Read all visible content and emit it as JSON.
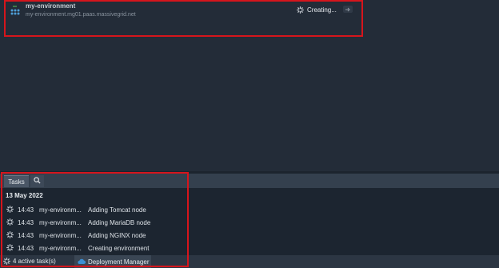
{
  "environment": {
    "name": "my-environment",
    "url": "my-environment.mg01.paas.massivegrid.net",
    "status": "Creating...",
    "icon": "nodes-icon",
    "action_icon": "arrow-icon"
  },
  "tabs": [
    {
      "label": "Tasks",
      "icon": null
    },
    {
      "label": "",
      "icon": "search-icon"
    }
  ],
  "tasks": {
    "date": "13 May 2022",
    "rows": [
      {
        "time": "14:43",
        "env": "my-environm...",
        "text": "Adding Tomcat node"
      },
      {
        "time": "14:43",
        "env": "my-environm...",
        "text": "Adding MariaDB node"
      },
      {
        "time": "14:43",
        "env": "my-environm...",
        "text": "Adding NGINX node"
      },
      {
        "time": "14:43",
        "env": "my-environm...",
        "text": "Creating environment"
      }
    ]
  },
  "status_bar": {
    "active_tasks": "4 active task(s)",
    "deployment_manager": "Deployment Manager"
  },
  "colors": {
    "background": "#232c38",
    "highlight": "#d6151c",
    "env_icon": "#4e9fd8",
    "cloud_icon": "#3b8fd4"
  }
}
